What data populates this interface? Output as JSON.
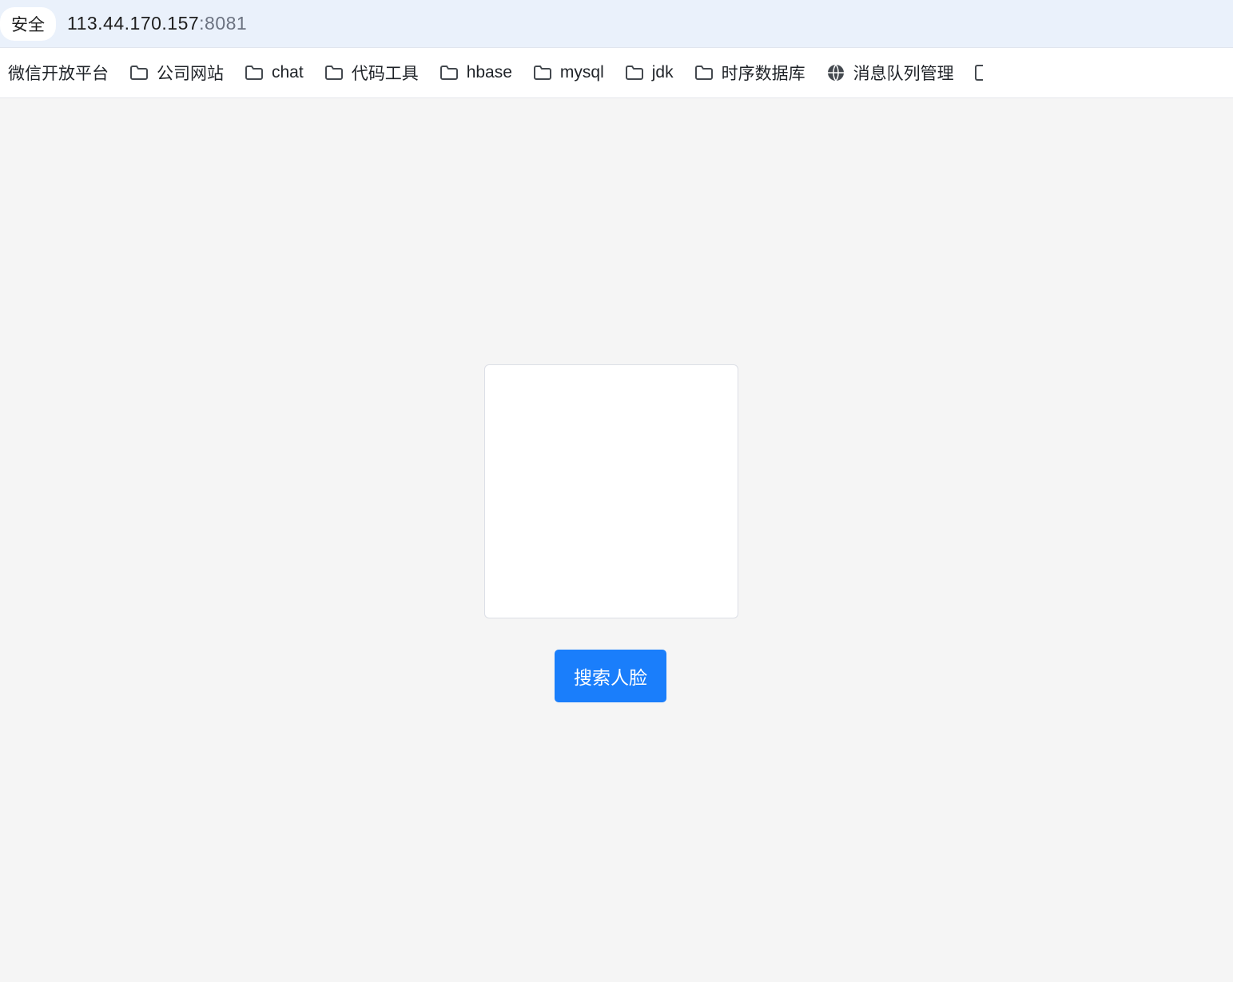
{
  "addressBar": {
    "securityBadge": "安全",
    "host": "113.44.170.157",
    "port": ":8081"
  },
  "bookmarks": {
    "items": [
      {
        "label": "微信开放平台",
        "icon": "none"
      },
      {
        "label": "公司网站",
        "icon": "folder"
      },
      {
        "label": "chat",
        "icon": "folder"
      },
      {
        "label": "代码工具",
        "icon": "folder"
      },
      {
        "label": "hbase",
        "icon": "folder"
      },
      {
        "label": "mysql",
        "icon": "folder"
      },
      {
        "label": "jdk",
        "icon": "folder"
      },
      {
        "label": "时序数据库",
        "icon": "folder"
      },
      {
        "label": "消息队列管理",
        "icon": "globe"
      }
    ]
  },
  "main": {
    "searchButtonLabel": "搜索人脸"
  }
}
